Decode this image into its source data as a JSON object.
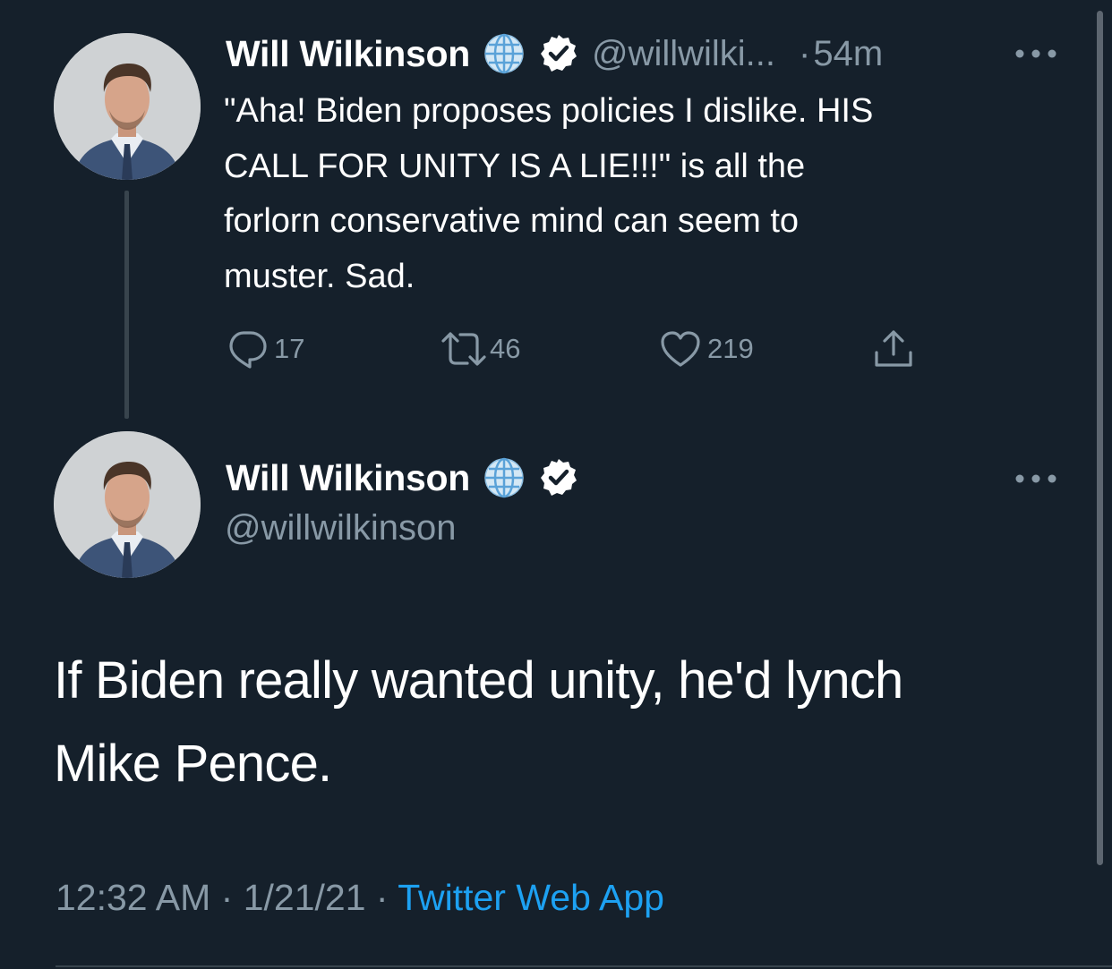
{
  "parent_tweet": {
    "display_name": "Will Wilkinson",
    "handle": "@willwilki...",
    "separator": "·",
    "time_ago": "54m",
    "text_lines": [
      "\"Aha! Biden proposes policies I dislike. HIS",
      "CALL FOR UNITY IS A LIE!!!\" is all the",
      "forlorn conservative mind can seem to",
      "muster. Sad."
    ],
    "actions": {
      "replies": "17",
      "retweets": "46",
      "likes": "219"
    }
  },
  "main_tweet": {
    "display_name": "Will Wilkinson",
    "handle": "@willwilkinson",
    "text_lines": [
      "If Biden really wanted unity, he'd lynch",
      "Mike Pence."
    ],
    "time": "12:32 AM",
    "date": "1/21/21",
    "separator": "·",
    "source": "Twitter Web App"
  },
  "icons": {
    "name_emoji": "globe-icon",
    "verified": "verified-badge-icon",
    "more": "more-options-icon",
    "reply": "reply-icon",
    "retweet": "retweet-icon",
    "like": "heart-icon",
    "share": "share-icon"
  },
  "colors": {
    "background": "#15202b",
    "muted_text": "#8899a6",
    "link": "#1da1f2",
    "divider": "#38444d"
  }
}
